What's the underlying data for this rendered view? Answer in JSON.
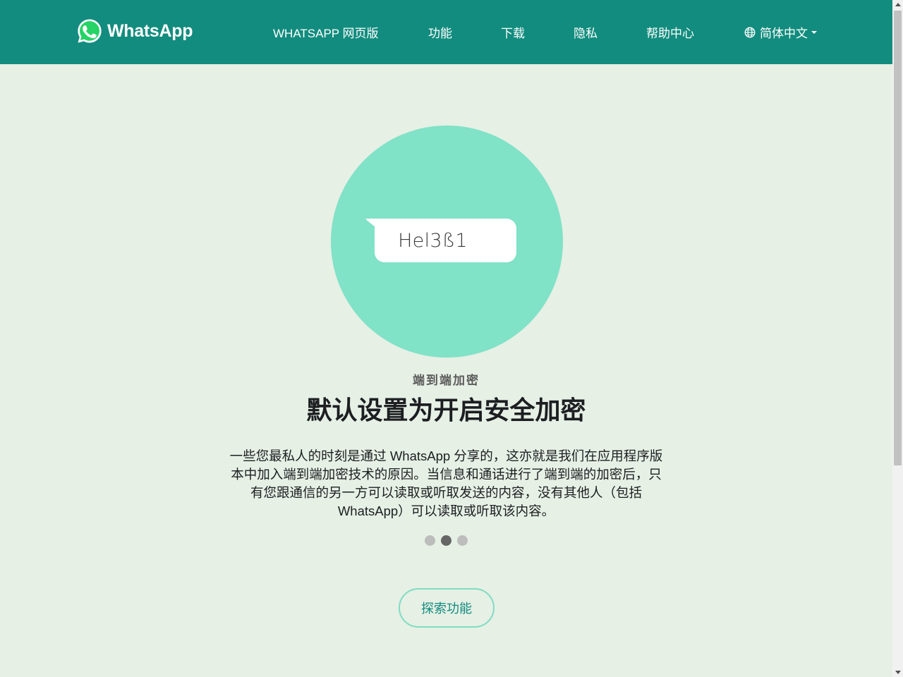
{
  "header": {
    "logo_text": "WhatsApp",
    "nav": {
      "web": "WHATSAPP 网页版",
      "features": "功能",
      "download": "下载",
      "privacy": "隐私",
      "help": "帮助中心"
    },
    "language": "简体中文"
  },
  "hero": {
    "bubble_text": "Hel3ß1",
    "eyebrow": "端到端加密",
    "headline": "默认设置为开启安全加密",
    "body": "一些您最私人的时刻是通过 WhatsApp 分享的，这亦就是我们在应用程序版本中加入端到端加密技术的原因。当信息和通话进行了端到端的加密后，只有您跟通信的另一方可以读取或听取发送的内容，没有其他人（包括 WhatsApp）可以读取或听取该内容。"
  },
  "carousel": {
    "total": 3,
    "active": 2
  },
  "cta": {
    "label": "探索功能"
  },
  "colors": {
    "header_bg": "#128c7e",
    "page_bg": "#e6f0e5",
    "circle": "#80e2c7",
    "logo_green": "#25d366",
    "cta_border": "#7fdcc3"
  },
  "icons": [
    "whatsapp-logo-icon",
    "globe-icon",
    "caret-down-icon"
  ]
}
